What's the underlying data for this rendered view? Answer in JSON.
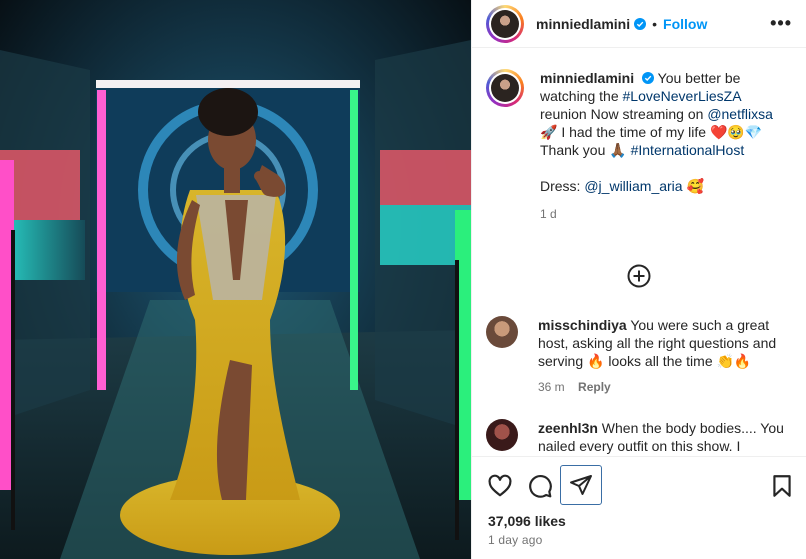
{
  "post": {
    "username": "minniedlamini",
    "follow_label": "Follow",
    "dot": "•",
    "more_label": "•••"
  },
  "caption": {
    "username": "minniedlamini",
    "line1_a": "You better be watching the ",
    "hashtag1": "#LoveNeverLiesZA",
    "line1_b": " reunion Now streaming on ",
    "mention1": "@netflixsa",
    "line1_c": " 🚀 I had the time of my life ❤️🥹💎",
    "line2_a": "Thank you 🙏🏾 ",
    "hashtag2": "#InternationalHost",
    "line3_a": "Dress: ",
    "mention2": "@j_william_aria",
    "line3_b": " 🥰",
    "time": "1 d"
  },
  "comments": [
    {
      "username": "misschindiya",
      "text": "You were such a great host, asking all the right questions and serving 🔥 looks all the time 👏🔥",
      "time": "36 m",
      "reply_label": "Reply"
    },
    {
      "username": "zeenhl3n",
      "text": "When the body bodies.... You nailed every outfit on this show. I"
    }
  ],
  "stats": {
    "likes": "37,096 likes",
    "ago": "1 day ago"
  },
  "icons": {
    "verified": "verified-badge-icon",
    "like": "heart-icon",
    "comment": "comment-bubble-icon",
    "share": "paper-plane-icon",
    "save": "bookmark-icon",
    "load_more": "plus-circle-icon"
  },
  "colors": {
    "accent": "#0095f6",
    "link": "#00376b",
    "verified": "#0095f6",
    "muted": "#737373"
  }
}
